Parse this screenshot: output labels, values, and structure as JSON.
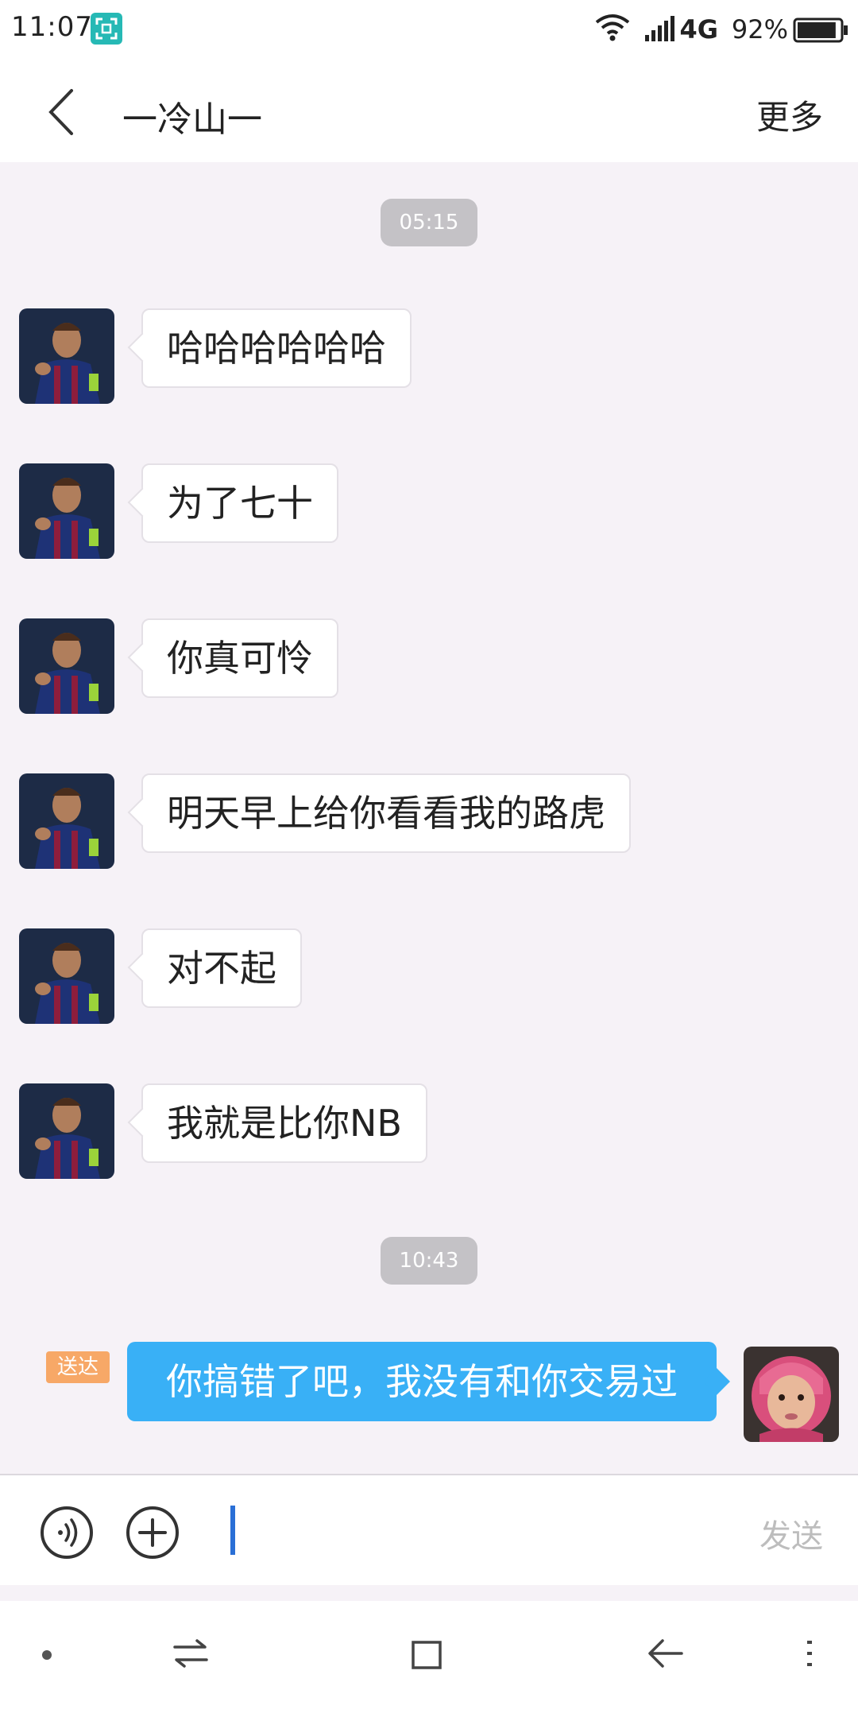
{
  "status_bar": {
    "time": "11:07",
    "network": "4G",
    "battery": "92%",
    "battery_level": 0.92
  },
  "header": {
    "title": "一冷山一",
    "more_label": "更多"
  },
  "chat": {
    "time_separators": [
      "05:15",
      "10:43"
    ],
    "received_messages": [
      {
        "text": "哈哈哈哈哈哈"
      },
      {
        "text": "为了七十"
      },
      {
        "text": "你真可怜"
      },
      {
        "text": "明天早上给你看看我的路虎"
      },
      {
        "text": "对不起"
      },
      {
        "text": "我就是比你NB"
      }
    ],
    "sent_message": {
      "status": "送达",
      "text": "你搞错了吧，我没有和你交易过"
    }
  },
  "input_bar": {
    "value": "",
    "send_label": "发送"
  },
  "colors": {
    "chat_background": "#f6f2f7",
    "sent_bubble": "#39b0f6",
    "sent_badge": "#f7a867",
    "time_pill": "#c4c2c6"
  }
}
